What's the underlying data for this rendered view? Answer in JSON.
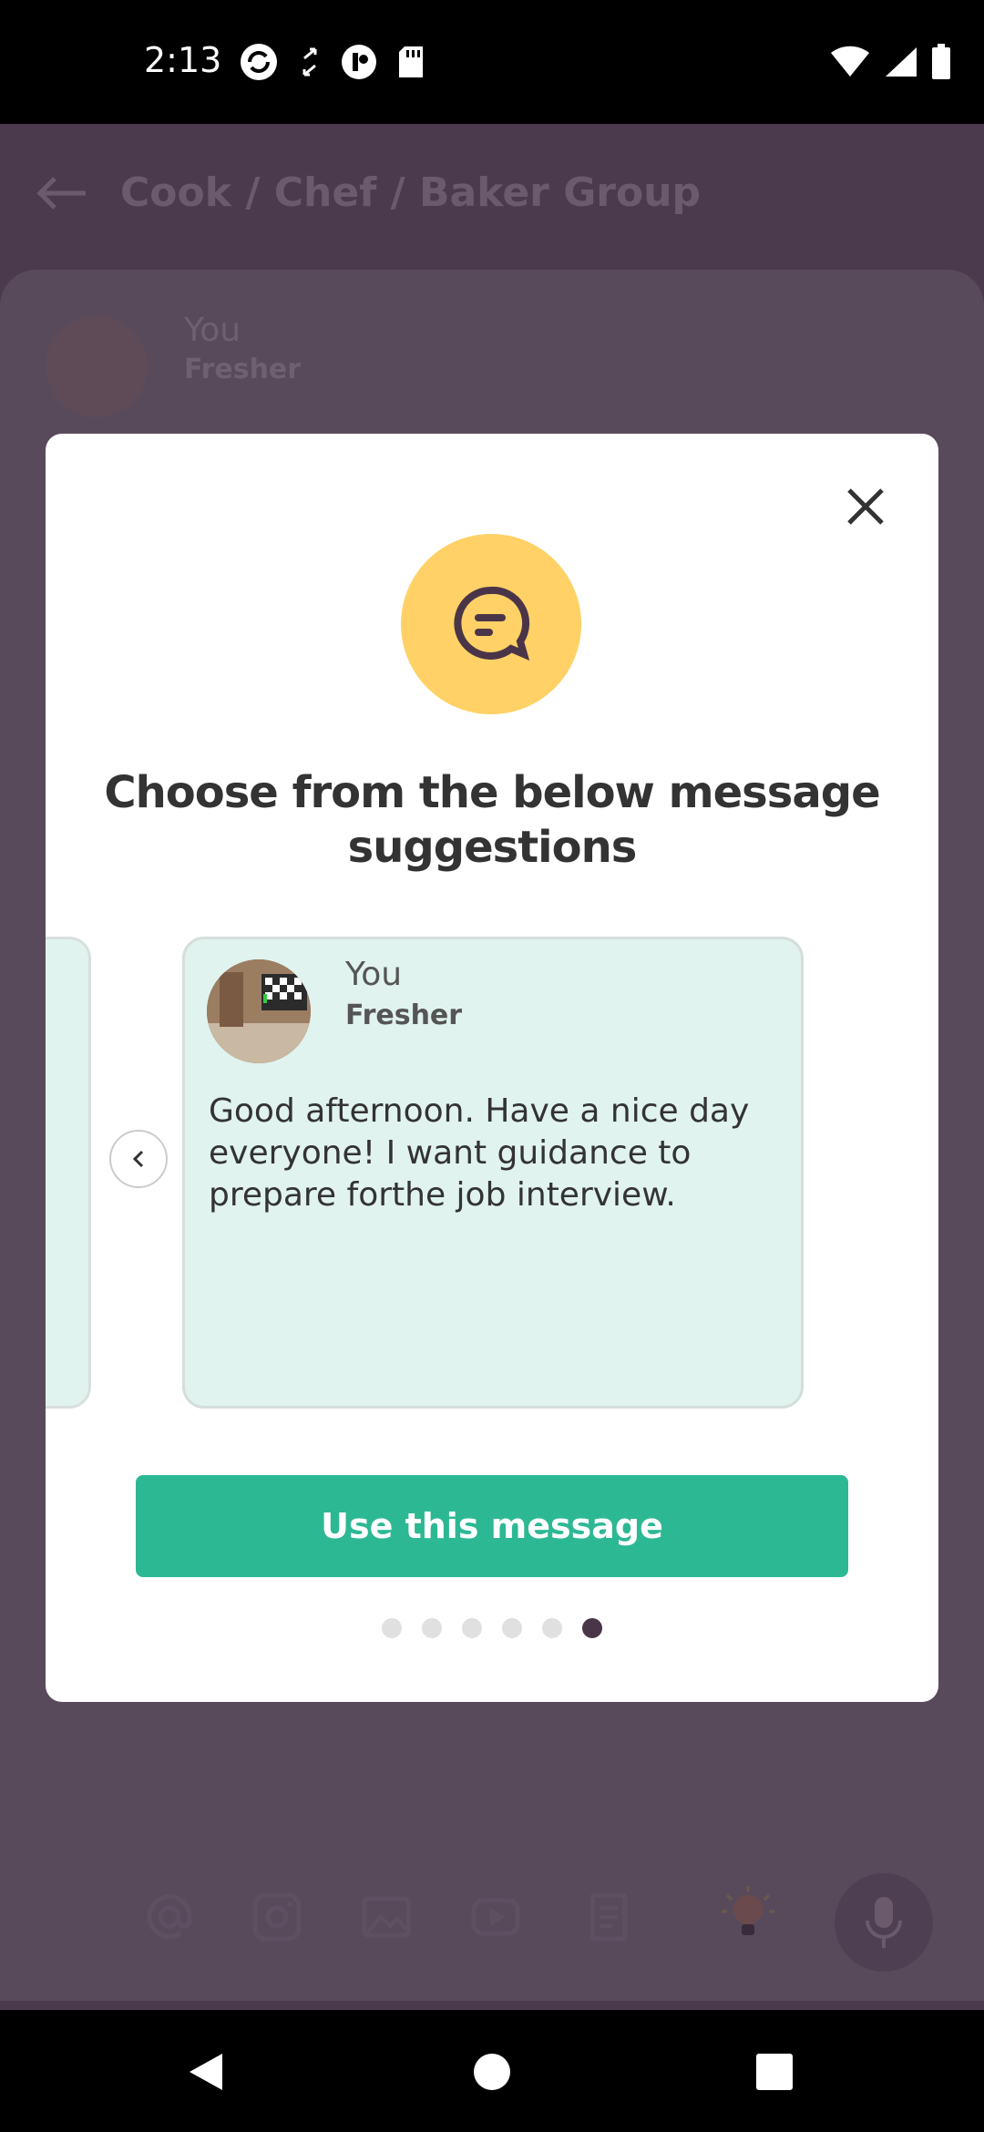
{
  "status_bar": {
    "time": "2:13",
    "icons_left": [
      "sync-icon",
      "transfer-icon",
      "app-icon",
      "sdcard-icon"
    ],
    "icons_right": [
      "wifi-icon",
      "signal-icon",
      "battery-icon"
    ]
  },
  "app": {
    "title": "Cook / Chef / Baker Group",
    "post": {
      "name": "You",
      "subtitle": "Fresher"
    },
    "toolbar_icons": [
      "at-icon",
      "instagram-icon",
      "image-icon",
      "youtube-icon",
      "document-icon",
      "bulb-icon",
      "mic-icon"
    ]
  },
  "modal": {
    "title": "Choose from the below message suggestions",
    "card": {
      "name": "You",
      "subtitle": "Fresher",
      "message": "Good afternoon. Have a nice day everyone! I want guidance to prepare forthe job interview."
    },
    "use_button_label": "Use this message",
    "pagination": {
      "total": 6,
      "active_index": 5
    }
  },
  "colors": {
    "accent": "#2db894",
    "icon_bg": "#ffd166",
    "card_bg": "#e0f3ef",
    "dim_bg": "#4b3a4d"
  }
}
